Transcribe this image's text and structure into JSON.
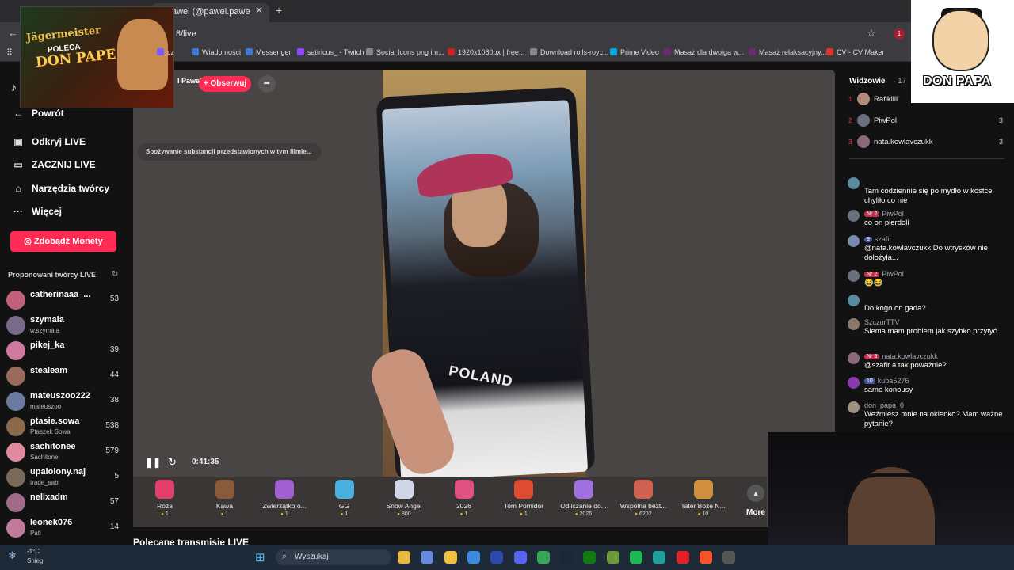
{
  "browser": {
    "tab_title": "el Pawel (@pawel.pawe",
    "url": "8/live",
    "bookmarks": [
      {
        "label": "cz",
        "color": "#7a5cff"
      },
      {
        "label": "Wiadomości",
        "color": "#3a7bd5"
      },
      {
        "label": "Messenger",
        "color": "#3a7bd5"
      },
      {
        "label": "satiricus_ - Twitch",
        "color": "#9146ff"
      },
      {
        "label": "Social Icons png im...",
        "color": "#888888"
      },
      {
        "label": "1920x1080px | free...",
        "color": "#d02020"
      },
      {
        "label": "Download rolls-royc...",
        "color": "#888888"
      },
      {
        "label": "Prime Video",
        "color": "#00a8e1"
      },
      {
        "label": "Masaż dla dwojga w...",
        "color": "#6a2c70"
      },
      {
        "label": "Masaż relaksacyjny...",
        "color": "#6a2c70"
      },
      {
        "label": "CV - CV Maker",
        "color": "#e0302a"
      }
    ]
  },
  "sidebar": {
    "nav": [
      {
        "icon": "←",
        "label": "Powrót"
      },
      {
        "icon": "▣",
        "label": "Odkryj LIVE"
      },
      {
        "icon": "▭",
        "label": "ZACZNIJ LIVE"
      },
      {
        "icon": "⌂",
        "label": "Narzędzia twórcy"
      },
      {
        "icon": "···",
        "label": "Więcej"
      }
    ],
    "coins_label": "Zdobądź Monety",
    "suggested_title": "Proponowani twórcy LIVE",
    "creators": [
      {
        "name": "catherinaaa_...",
        "sub": "",
        "count": "53",
        "color": "#c0607a"
      },
      {
        "name": "szymala",
        "sub": "w.szymala",
        "count": "",
        "color": "#7a6a8a"
      },
      {
        "name": "pikej_ka",
        "sub": "",
        "count": "39",
        "color": "#d07aa0"
      },
      {
        "name": "stealeam",
        "sub": "",
        "count": "44",
        "color": "#9a6a5a"
      },
      {
        "name": "mateuszoo222",
        "sub": "mateuszoo",
        "count": "38",
        "color": "#6a7aa0"
      },
      {
        "name": "ptasie.sowa",
        "sub": "Ptaszek Sowa",
        "count": "538",
        "color": "#8a6a4a"
      },
      {
        "name": "sachitonee",
        "sub": "Sachitone",
        "count": "579",
        "color": "#e08aa0"
      },
      {
        "name": "upalolony.naj",
        "sub": "trade_sab",
        "count": "5",
        "color": "#7a6a5a"
      },
      {
        "name": "nellxadm",
        "sub": "",
        "count": "57",
        "color": "#a06a8a"
      },
      {
        "name": "leonek076",
        "sub": "Pati",
        "count": "14",
        "color": "#c07a9a"
      }
    ]
  },
  "stream": {
    "host_name": "l Pawel",
    "follow_label": "+ Obserwuj",
    "disclaimer": "Spożywanie substancji przedstawionych w tym filmie...",
    "shirt_text": "POLAND",
    "timer": "0:41:35",
    "gifts": [
      {
        "name": "Róża",
        "price": "1",
        "color": "#e0406a"
      },
      {
        "name": "Kawa",
        "price": "1",
        "color": "#8a5a3a"
      },
      {
        "name": "Zwierzątko o...",
        "price": "1",
        "color": "#a060d0"
      },
      {
        "name": "GG",
        "price": "1",
        "color": "#4ab0e0"
      },
      {
        "name": "Snow Angel",
        "price": "800",
        "color": "#d0d8e8"
      },
      {
        "name": "2026",
        "price": "1",
        "color": "#e05080"
      },
      {
        "name": "Tom Pomidor",
        "price": "1",
        "color": "#e04a30"
      },
      {
        "name": "Odliczanie do...",
        "price": "2026",
        "color": "#a070e0"
      },
      {
        "name": "Wspólna bezt...",
        "price": "6202",
        "color": "#d06050"
      },
      {
        "name": "Tater Boże N...",
        "price": "10",
        "color": "#d09040"
      }
    ],
    "more_label": "More",
    "recommended_title": "Polecane transmisje LIVE"
  },
  "chat": {
    "viewers_title": "Widzowie",
    "viewers_count": "· 17",
    "viewers": [
      {
        "rank": "1",
        "name": "Rafikiiii",
        "score": "",
        "color": "#b08a7a"
      },
      {
        "rank": "2",
        "name": "PiwPol",
        "score": "3",
        "color": "#6a7080"
      },
      {
        "rank": "3",
        "name": "nata.kowlavczukk",
        "score": "3",
        "color": "#8a6a7a"
      }
    ],
    "messages": [
      {
        "user": "",
        "badge": "",
        "text": "Tam codziennie się po mydło w kostce chyliło co nie",
        "color": "#5a8aa0"
      },
      {
        "user": "PiwPol",
        "badge": "Nr 2",
        "text": "co on pierdoli",
        "color": "#6a7080"
      },
      {
        "user": "szafir",
        "badge": "9",
        "text": "@nata.kowlavczukk Do wtrysków nie dołożyła...",
        "color": "#7a8ab0"
      },
      {
        "user": "PiwPol",
        "badge": "Nr 2",
        "text": "😂😂",
        "color": "#6a7080"
      },
      {
        "user": "",
        "badge": "",
        "text": "Do kogo on gada?",
        "color": "#5a8aa0"
      },
      {
        "user": "SzczurTTV",
        "badge": "",
        "text": "Siema mam problem jak szybko przytyć",
        "color": "#8a7a6a"
      },
      {
        "user": "nata.kowlavczukk",
        "badge": "Nr 3",
        "text": "@szafir a tak poważnie?",
        "color": "#8a6a7a"
      },
      {
        "user": "kuba5276",
        "badge": "10",
        "text": "same konousy",
        "color": "#8a3ab0"
      },
      {
        "user": "don_papa_0",
        "badge": "",
        "text": "Weźmiesz mnie na okienko? Mam ważne pytanie?",
        "color": "#a09080"
      }
    ]
  },
  "overlays": {
    "promo_top": "Jägermeister",
    "promo_mid": "POLECA",
    "promo_bottom": "DON PAPE",
    "logo_text": "DON PAPA"
  },
  "taskbar": {
    "temp": "-1°C",
    "weather": "Śnieg",
    "search_placeholder": "Wyszukaj",
    "apps": [
      {
        "name": "file-explorer",
        "color": "#e8b840"
      },
      {
        "name": "copilot",
        "color": "#6a8ae0"
      },
      {
        "name": "folder",
        "color": "#f0c040"
      },
      {
        "name": "store",
        "color": "#3a8ae0"
      },
      {
        "name": "app-l",
        "color": "#2a4ab0"
      },
      {
        "name": "discord",
        "color": "#5865f2"
      },
      {
        "name": "chrome",
        "color": "#34a853"
      },
      {
        "name": "steam",
        "color": "#1b2838"
      },
      {
        "name": "xbox",
        "color": "#107c10"
      },
      {
        "name": "minecraft",
        "color": "#6a9a3a"
      },
      {
        "name": "spotify",
        "color": "#1db954"
      },
      {
        "name": "tiktok-live",
        "color": "#20a0a0"
      },
      {
        "name": "opera",
        "color": "#e0202a"
      },
      {
        "name": "brave",
        "color": "#fb542b"
      },
      {
        "name": "media",
        "color": "#555555"
      }
    ]
  }
}
